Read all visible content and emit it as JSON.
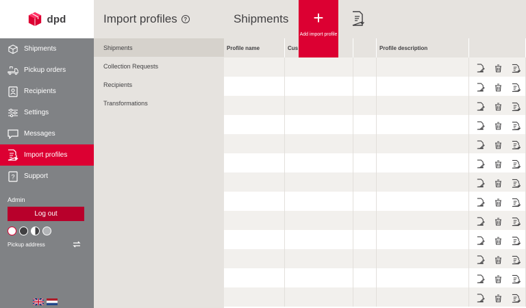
{
  "brand": {
    "name": "dpd",
    "accent": "#dc0032"
  },
  "sidebar": {
    "items": [
      {
        "label": "Shipments",
        "icon": "package-icon"
      },
      {
        "label": "Pickup orders",
        "icon": "truck-icon"
      },
      {
        "label": "Recipients",
        "icon": "contact-card-icon"
      },
      {
        "label": "Settings",
        "icon": "sliders-icon"
      },
      {
        "label": "Messages",
        "icon": "chat-icon"
      },
      {
        "label": "Import profiles",
        "icon": "import-file-icon",
        "active": true
      },
      {
        "label": "Support",
        "icon": "help-icon"
      }
    ],
    "user": {
      "name": "Admin",
      "logout_label": "Log out"
    },
    "pickup_label": "Pickup address"
  },
  "submenu": {
    "title": "Import profiles",
    "items": [
      "Shipments",
      "Collection Requests",
      "Recipients",
      "Transformations"
    ],
    "active_index": 0
  },
  "main": {
    "title": "Shipments",
    "add_button": {
      "symbol": "+",
      "label": "Add import profile"
    },
    "columns": [
      "Profile name",
      "Cus",
      "",
      "Profile description",
      ""
    ],
    "row_count": 13
  }
}
